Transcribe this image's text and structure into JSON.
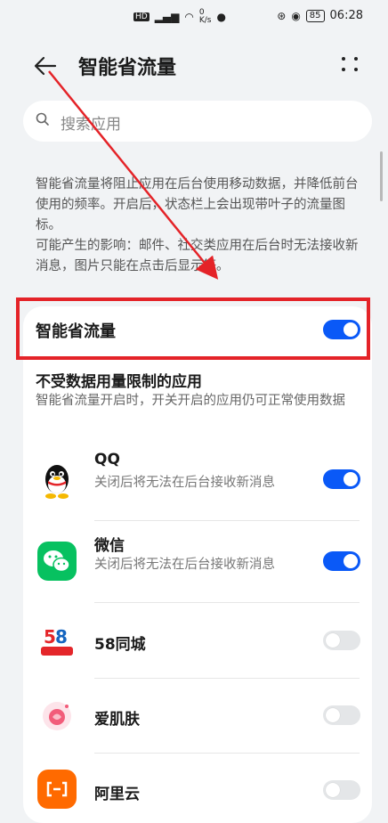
{
  "status_bar": {
    "left_icons": [
      "HD",
      "4G",
      "signal",
      "wifi",
      "0 K/s",
      "message"
    ],
    "right_icons": [
      "data-saver",
      "eye-comfort"
    ],
    "battery": "85",
    "time": "06:28"
  },
  "header": {
    "title": "智能省流量"
  },
  "search": {
    "placeholder": "搜索应用"
  },
  "description": {
    "paragraph1": "智能省流量将阻止应用在后台使用移动数据，并降低前台使用的频率。开启后，状态栏上会出现带叶子的流量图标。",
    "paragraph2": "可能产生的影响：邮件、社交类应用在后台时无法接收新消息，图片只能在点击后显示等。"
  },
  "main_toggle": {
    "label": "智能省流量",
    "state": "on"
  },
  "exempt_section": {
    "title": "不受数据用量限制的应用",
    "subtitle": "智能省流量开启时，开关开启的应用仍可正常使用数据"
  },
  "apps": [
    {
      "name": "QQ",
      "note": "关闭后将无法在后台接收新消息",
      "state": "on",
      "icon": "qq-icon"
    },
    {
      "name": "微信",
      "note": "关闭后将无法在后台接收新消息",
      "state": "on",
      "icon": "wechat-icon"
    },
    {
      "name": "58同城",
      "note": "",
      "state": "off",
      "icon": "58-icon"
    },
    {
      "name": "爱肌肤",
      "note": "",
      "state": "off",
      "icon": "aijifu-icon"
    },
    {
      "name": "阿里云",
      "note": "",
      "state": "off",
      "icon": "aliyun-icon"
    }
  ],
  "colors": {
    "accent": "#0a59f7",
    "highlight_box": "#e42328",
    "background": "#f1f3f5"
  }
}
